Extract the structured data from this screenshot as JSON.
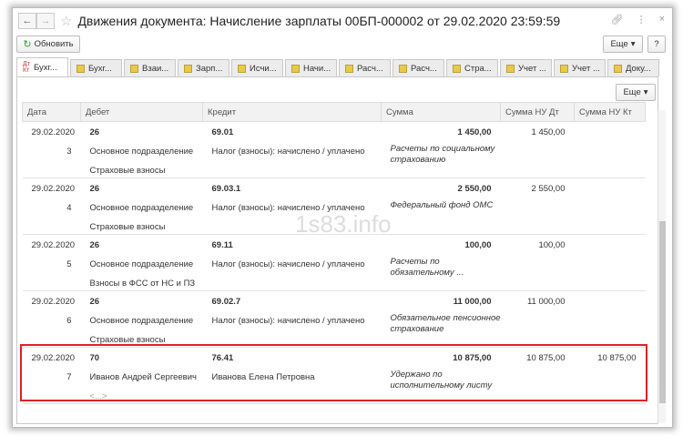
{
  "window": {
    "title": "Движения документа: Начисление зарплаты 00БП-000002 от 29.02.2020 23:59:59"
  },
  "toolbar": {
    "refresh": "Обновить",
    "more": "Еще",
    "help": "?"
  },
  "tabs": [
    "Бухг...",
    "Бухг...",
    "Взаи...",
    "Зарп...",
    "Исчи...",
    "Начи...",
    "Расч...",
    "Расч...",
    "Стра...",
    "Учет ...",
    "Учет ...",
    "Доку..."
  ],
  "panel": {
    "more": "Еще"
  },
  "columns": [
    "Дата",
    "Дебет",
    "Кредит",
    "Сумма",
    "Сумма НУ Дт",
    "Сумма НУ Кт"
  ],
  "rows": [
    {
      "date": "29.02.2020",
      "num": "3",
      "debit": "26",
      "debit2": "Основное подразделение",
      "debit3": "Страховые взносы",
      "credit": "69.01",
      "credit2": "Налог (взносы): начислено / уплачено",
      "sum": "1 450,00",
      "desc": "Расчеты по социальному страхованию",
      "nu_dt": "1 450,00",
      "nu_kt": ""
    },
    {
      "date": "29.02.2020",
      "num": "4",
      "debit": "26",
      "debit2": "Основное подразделение",
      "debit3": "Страховые взносы",
      "credit": "69.03.1",
      "credit2": "Налог (взносы): начислено / уплачено",
      "sum": "2 550,00",
      "desc": "Федеральный фонд ОМС",
      "nu_dt": "2 550,00",
      "nu_kt": ""
    },
    {
      "date": "29.02.2020",
      "num": "5",
      "debit": "26",
      "debit2": "Основное подразделение",
      "debit3": "Взносы в ФСС от НС и ПЗ",
      "credit": "69.11",
      "credit2": "Налог (взносы): начислено / уплачено",
      "sum": "100,00",
      "desc": "Расчеты по обязательному ...",
      "nu_dt": "100,00",
      "nu_kt": ""
    },
    {
      "date": "29.02.2020",
      "num": "6",
      "debit": "26",
      "debit2": "Основное подразделение",
      "debit3": "Страховые взносы",
      "credit": "69.02.7",
      "credit2": "Налог (взносы): начислено / уплачено",
      "sum": "11 000,00",
      "desc": "Обязательное пенсионное страхование",
      "nu_dt": "11 000,00",
      "nu_kt": ""
    },
    {
      "date": "29.02.2020",
      "num": "7",
      "debit": "70",
      "debit2": "Иванов Андрей Сергеевич",
      "debit3": "<...>",
      "credit": "76.41",
      "credit2": "Иванова Елена Петровна",
      "sum": "10 875,00",
      "desc": "Удержано по исполнительному листу",
      "nu_dt": "10 875,00",
      "nu_kt": "10 875,00"
    }
  ],
  "watermark": "1s83.info"
}
